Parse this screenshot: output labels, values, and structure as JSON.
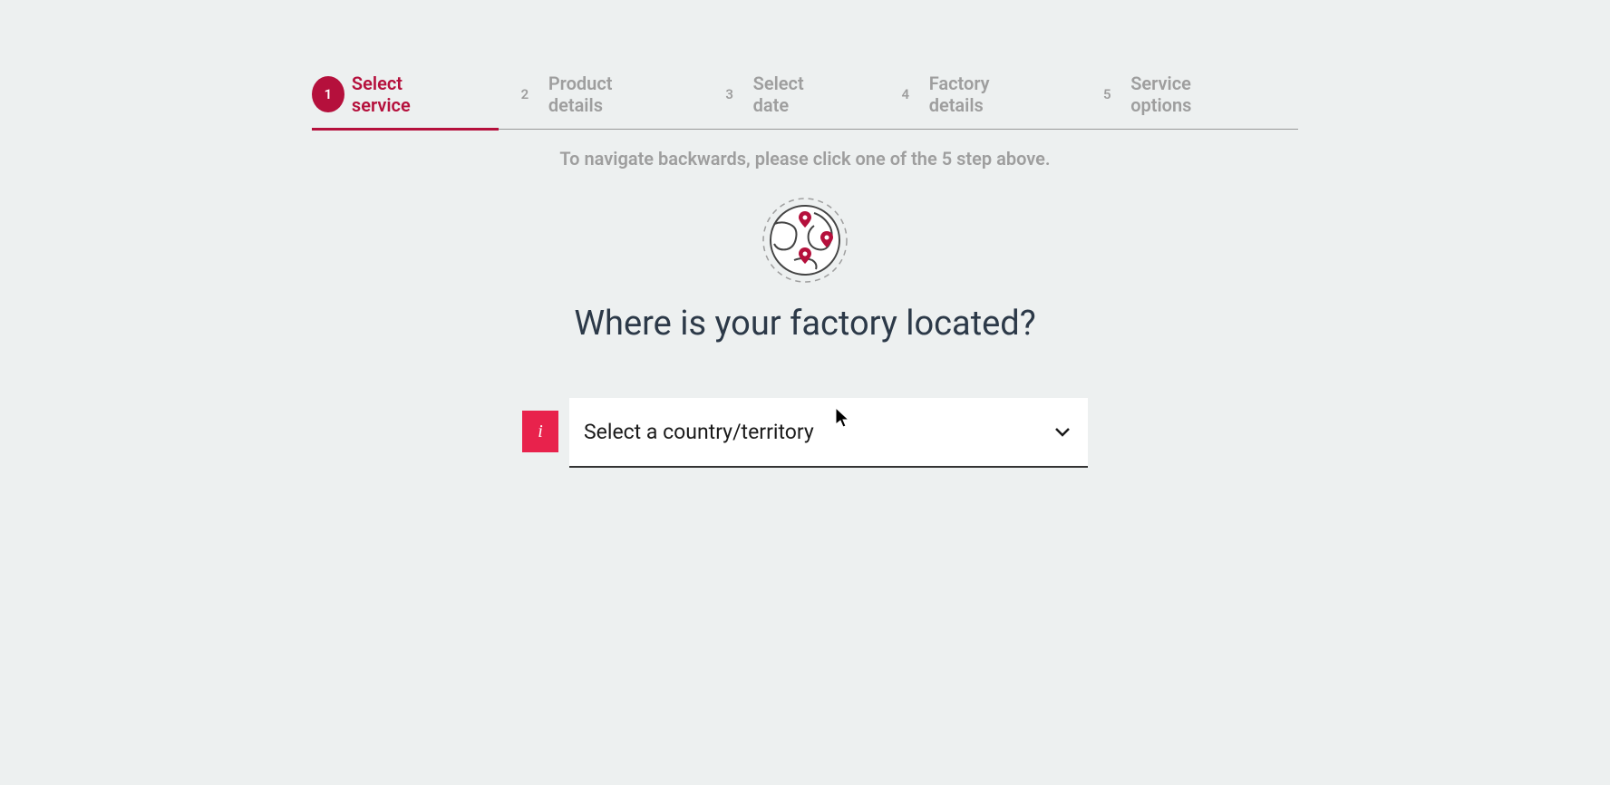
{
  "stepper": {
    "steps": [
      {
        "num": "1",
        "label": "Select service"
      },
      {
        "num": "2",
        "label": "Product details"
      },
      {
        "num": "3",
        "label": "Select date"
      },
      {
        "num": "4",
        "label": "Factory details"
      },
      {
        "num": "5",
        "label": "Service options"
      }
    ],
    "active_index": 0
  },
  "hint": "To navigate backwards, please click one of the 5 step above.",
  "heading": "Where is your factory located?",
  "info_badge": "i",
  "select": {
    "placeholder": "Select a country/territory"
  },
  "colors": {
    "accent": "#b5103c",
    "info_badge": "#e8224c",
    "inactive": "#9e9e9e",
    "heading": "#2c3948",
    "background": "#edf0f0"
  }
}
